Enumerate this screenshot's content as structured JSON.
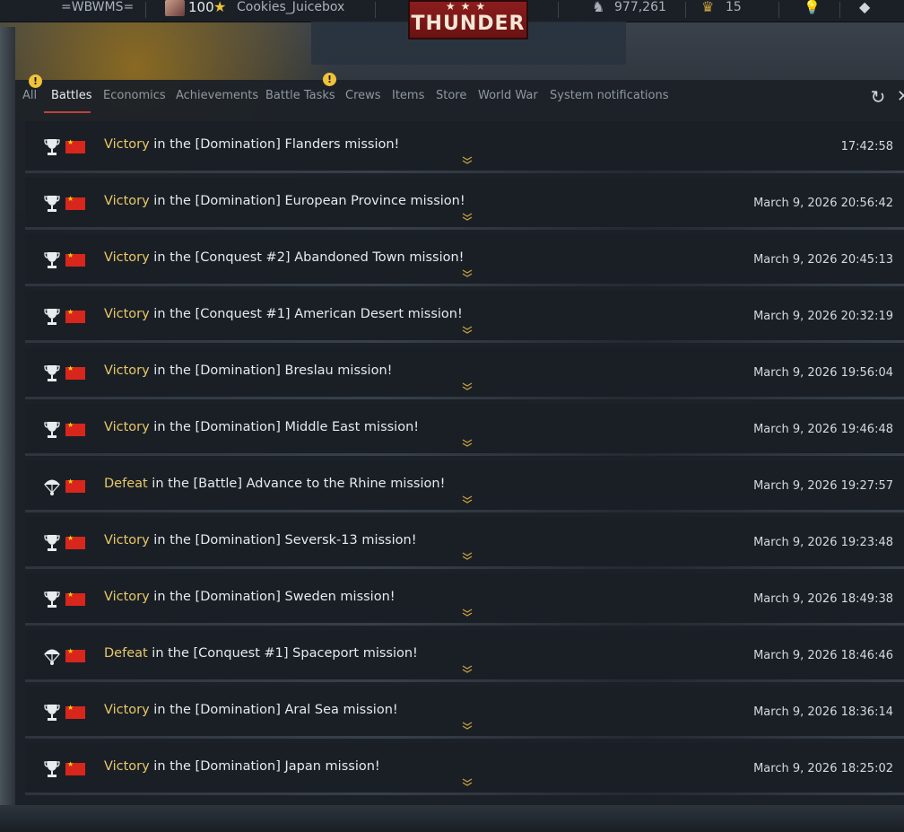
{
  "topbar": {
    "squadron": "=WBWMS=",
    "level": "100",
    "username": "Cookies_Juicebox",
    "logo_text": "THUNDER",
    "silver_lions": "977,261",
    "golden_eagles": "15"
  },
  "tabs": [
    {
      "label": "All",
      "active": false,
      "alert": true
    },
    {
      "label": "Battles",
      "active": true,
      "alert": false
    },
    {
      "label": "Economics",
      "active": false,
      "alert": false
    },
    {
      "label": "Achievements",
      "active": false,
      "alert": false
    },
    {
      "label": "Battle Tasks",
      "active": false,
      "alert": true
    },
    {
      "label": "Crews",
      "active": false,
      "alert": false
    },
    {
      "label": "Items",
      "active": false,
      "alert": false
    },
    {
      "label": "Store",
      "active": false,
      "alert": false
    },
    {
      "label": "World War",
      "active": false,
      "alert": false
    },
    {
      "label": "System notifications",
      "active": false,
      "alert": false
    }
  ],
  "alert_symbol": "!",
  "battles": [
    {
      "outcome": "Victory",
      "text": " in the [Domination] Flanders mission!",
      "time": "17:42:58",
      "icon": "trophy-icon"
    },
    {
      "outcome": "Victory",
      "text": " in the [Domination] European Province mission!",
      "time": "March 9, 2026 20:56:42",
      "icon": "trophy-icon"
    },
    {
      "outcome": "Victory",
      "text": " in the [Conquest #2] Abandoned Town mission!",
      "time": "March 9, 2026 20:45:13",
      "icon": "trophy-icon"
    },
    {
      "outcome": "Victory",
      "text": " in the [Conquest #1] American Desert mission!",
      "time": "March 9, 2026 20:32:19",
      "icon": "trophy-icon"
    },
    {
      "outcome": "Victory",
      "text": " in the [Domination] Breslau mission!",
      "time": "March 9, 2026 19:56:04",
      "icon": "trophy-icon"
    },
    {
      "outcome": "Victory",
      "text": " in the [Domination] Middle East mission!",
      "time": "March 9, 2026 19:46:48",
      "icon": "trophy-icon"
    },
    {
      "outcome": "Defeat",
      "text": " in the [Battle] Advance to the Rhine mission!",
      "time": "March 9, 2026 19:27:57",
      "icon": "parachute-icon"
    },
    {
      "outcome": "Victory",
      "text": " in the [Domination] Seversk-13 mission!",
      "time": "March 9, 2026 19:23:48",
      "icon": "trophy-icon"
    },
    {
      "outcome": "Victory",
      "text": " in the [Domination] Sweden mission!",
      "time": "March 9, 2026 18:49:38",
      "icon": "trophy-icon"
    },
    {
      "outcome": "Defeat",
      "text": " in the [Conquest #1] Spaceport mission!",
      "time": "March 9, 2026 18:46:46",
      "icon": "parachute-icon"
    },
    {
      "outcome": "Victory",
      "text": " in the [Domination] Aral Sea mission!",
      "time": "March 9, 2026 18:36:14",
      "icon": "trophy-icon"
    },
    {
      "outcome": "Victory",
      "text": " in the [Domination] Japan mission!",
      "time": "March 9, 2026 18:25:02",
      "icon": "trophy-icon"
    }
  ],
  "colors": {
    "accent_gold": "#e9c868",
    "tab_underline": "#c0423a",
    "alert_badge": "#f0c23a",
    "flag_red": "#d8261c"
  }
}
